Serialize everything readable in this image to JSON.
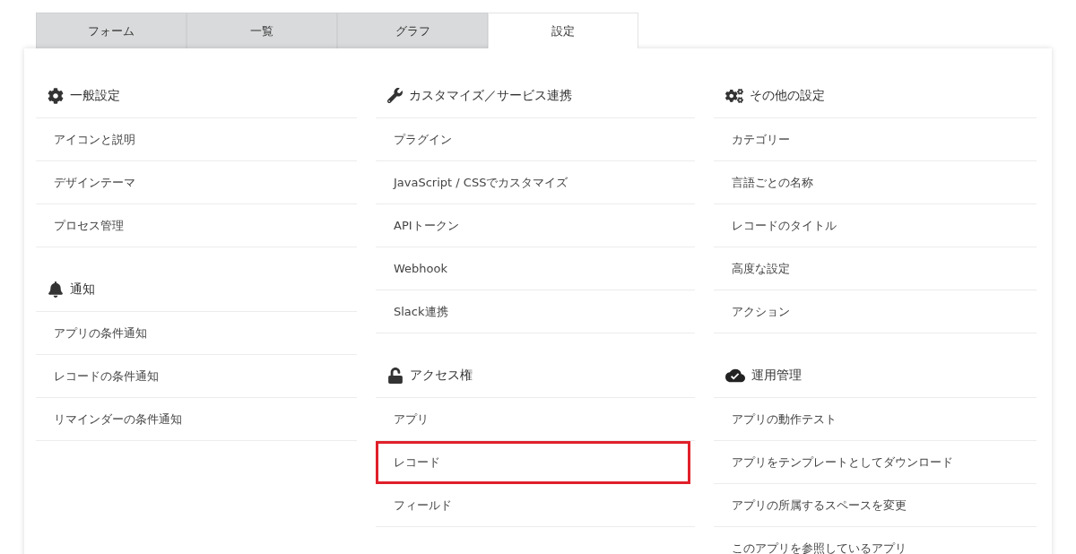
{
  "tabs": [
    {
      "label": "フォーム",
      "selected": false
    },
    {
      "label": "一覧",
      "selected": false
    },
    {
      "label": "グラフ",
      "selected": false
    },
    {
      "label": "設定",
      "selected": true
    }
  ],
  "columns": [
    {
      "sections": [
        {
          "title": "一般設定",
          "items": [
            {
              "label": "アイコンと説明",
              "highlighted": false
            },
            {
              "label": "デザインテーマ",
              "highlighted": false
            },
            {
              "label": "プロセス管理",
              "highlighted": false
            }
          ]
        },
        {
          "title": "通知",
          "items": [
            {
              "label": "アプリの条件通知",
              "highlighted": false
            },
            {
              "label": "レコードの条件通知",
              "highlighted": false
            },
            {
              "label": "リマインダーの条件通知",
              "highlighted": false
            }
          ]
        }
      ]
    },
    {
      "sections": [
        {
          "title": "カスタマイズ／サービス連携",
          "items": [
            {
              "label": "プラグイン",
              "highlighted": false
            },
            {
              "label": "JavaScript / CSSでカスタマイズ",
              "highlighted": false
            },
            {
              "label": "APIトークン",
              "highlighted": false
            },
            {
              "label": "Webhook",
              "highlighted": false
            },
            {
              "label": "Slack連携",
              "highlighted": false
            }
          ]
        },
        {
          "title": "アクセス権",
          "items": [
            {
              "label": "アプリ",
              "highlighted": false
            },
            {
              "label": "レコード",
              "highlighted": true
            },
            {
              "label": "フィールド",
              "highlighted": false
            }
          ]
        }
      ]
    },
    {
      "sections": [
        {
          "title": "その他の設定",
          "items": [
            {
              "label": "カテゴリー",
              "highlighted": false
            },
            {
              "label": "言語ごとの名称",
              "highlighted": false
            },
            {
              "label": "レコードのタイトル",
              "highlighted": false
            },
            {
              "label": "高度な設定",
              "highlighted": false
            },
            {
              "label": "アクション",
              "highlighted": false
            }
          ]
        },
        {
          "title": "運用管理",
          "items": [
            {
              "label": "アプリの動作テスト",
              "highlighted": false
            },
            {
              "label": "アプリをテンプレートとしてダウンロード",
              "highlighted": false
            },
            {
              "label": "アプリの所属するスペースを変更",
              "highlighted": false
            },
            {
              "label": "このアプリを参照しているアプリ",
              "highlighted": false
            }
          ]
        }
      ]
    }
  ]
}
